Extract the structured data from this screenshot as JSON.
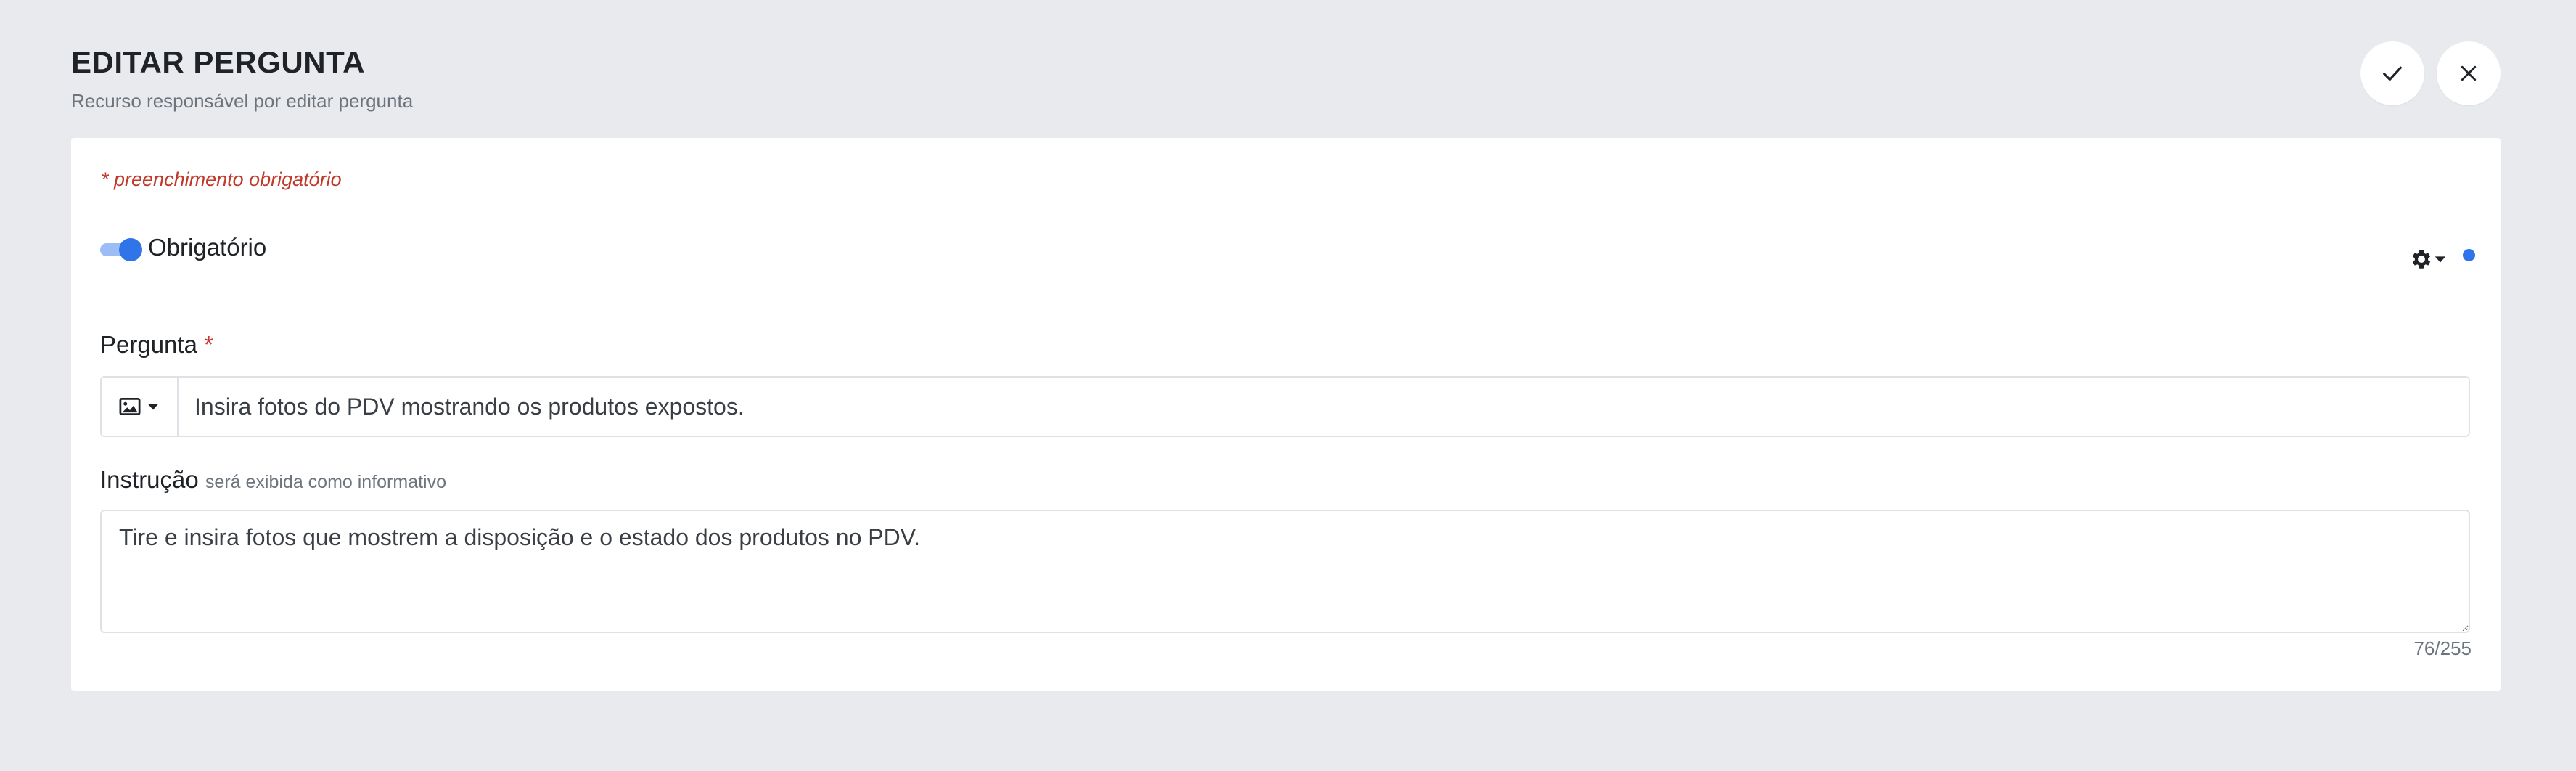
{
  "header": {
    "title": "EDITAR PERGUNTA",
    "subtitle": "Recurso responsável por editar pergunta"
  },
  "actions": {
    "confirm_icon": "check-icon",
    "close_icon": "close-icon"
  },
  "form": {
    "required_note": "* preenchimento obrigatório",
    "required_toggle": {
      "label": "Obrigatório",
      "on": true
    },
    "settings_icon": "gear-icon",
    "question": {
      "label": "Pergunta",
      "required_marker": "*",
      "type_icon": "image-icon",
      "value": "Insira fotos do PDV mostrando os produtos expostos."
    },
    "instruction": {
      "label": "Instrução",
      "hint": "será exibida como informativo",
      "value": "Tire e insira fotos que mostrem a disposição e o estado dos produtos no PDV.",
      "counter": "76/255"
    }
  },
  "colors": {
    "background": "#e9eaee",
    "accent": "#2f74e8",
    "required": "#c0392b"
  }
}
